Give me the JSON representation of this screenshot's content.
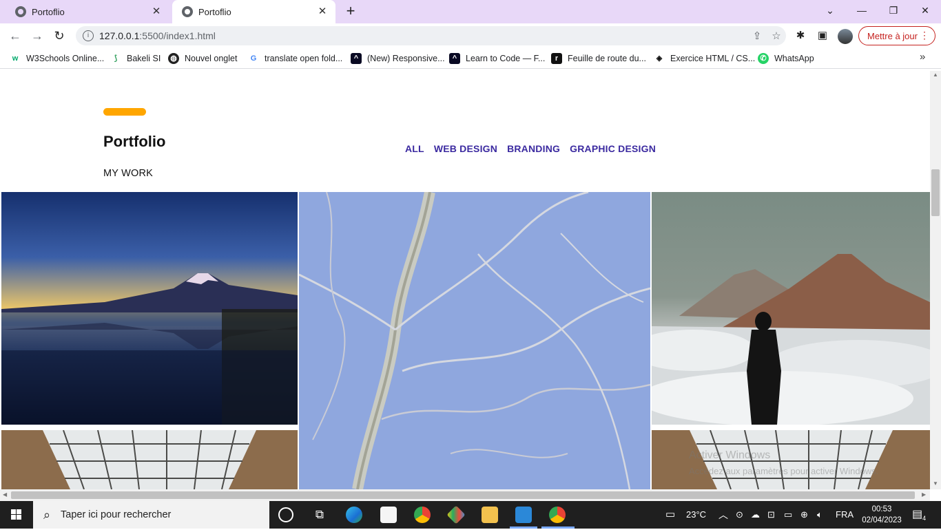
{
  "browser": {
    "tabs": [
      {
        "title": "Portoflio",
        "active": false
      },
      {
        "title": "Portoflio",
        "active": true
      }
    ],
    "url_host": "127.0.0.1",
    "url_rest": ":5500/index1.html",
    "update_button": "Mettre à jour",
    "bookmarks": [
      {
        "label": "W3Schools Online...",
        "icon": "w3schools-icon",
        "color": "#04aa6d"
      },
      {
        "label": "Bakeli SI",
        "icon": "bakeli-icon",
        "color": "#2e9e5b"
      },
      {
        "label": "Nouvel onglet",
        "icon": "globe-icon",
        "color": "#222222"
      },
      {
        "label": "translate open fold...",
        "icon": "google-icon",
        "color": "#4285f4"
      },
      {
        "label": "(New) Responsive...",
        "icon": "freecodecamp-icon",
        "color": "#0a0a23"
      },
      {
        "label": "Learn to Code — F...",
        "icon": "freecodecamp-icon",
        "color": "#0a0a23"
      },
      {
        "label": "Feuille de route du...",
        "icon": "document-icon",
        "color": "#111111"
      },
      {
        "label": "Exercice HTML / CS...",
        "icon": "codepen-icon",
        "color": "#111111"
      },
      {
        "label": "WhatsApp",
        "icon": "whatsapp-icon",
        "color": "#25d366"
      }
    ]
  },
  "page": {
    "heading": "Portfolio",
    "subheading": "MY WORK",
    "filters": [
      "ALL",
      "WEB DESIGN",
      "BRANDING",
      "GRAPHIC DESIGN"
    ],
    "accent_color": "#ffa600",
    "filter_color": "#3b2aa0"
  },
  "watermark": {
    "line1": "Activer Windows",
    "line2": "Accédez aux paramètres pour activer Windows."
  },
  "taskbar": {
    "search_placeholder": "Taper ici pour rechercher",
    "weather": "23°C",
    "language": "FRA",
    "time": "00:53",
    "date": "02/04/2023",
    "notifications": "4"
  }
}
